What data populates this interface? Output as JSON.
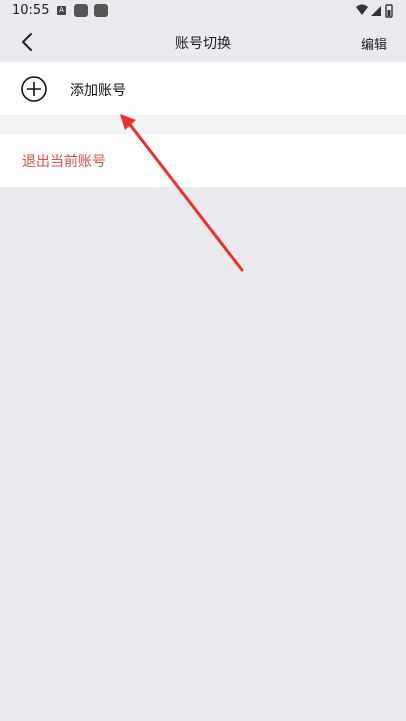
{
  "status_bar": {
    "time": "10:55",
    "a_badge": "A",
    "icons": [
      "wifi-icon",
      "signal-icon",
      "battery-icon"
    ]
  },
  "nav": {
    "title": "账号切换",
    "edit_label": "编辑",
    "back_icon": "chevron-left-icon"
  },
  "accounts": {
    "add_label": "添加账号",
    "add_icon": "plus-circle-icon"
  },
  "logout": {
    "label": "退出当前账号"
  },
  "colors": {
    "background": "#e9e9ee",
    "danger": "#e24b4b",
    "annotation": "#f0302b"
  }
}
